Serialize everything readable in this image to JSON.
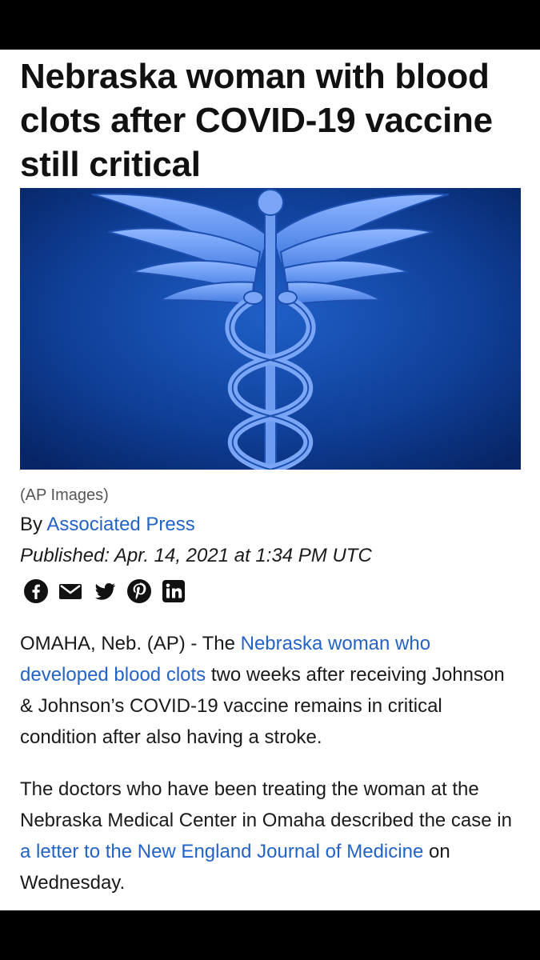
{
  "article": {
    "headline": "Nebraska woman with blood clots after COVID-19 vaccine still critical",
    "image_caption": "(AP Images)",
    "byline_prefix": "By",
    "byline_author": "Associated Press",
    "published": "Published: Apr. 14, 2021 at 1:34 PM UTC",
    "share_icons": [
      "facebook-icon",
      "email-icon",
      "twitter-icon",
      "pinterest-icon",
      "linkedin-icon"
    ],
    "paragraph1": {
      "before": "OMAHA, Neb. (AP) - The ",
      "link": "Nebraska woman who developed blood clots",
      "after": " two weeks after receiving Johnson & Johnson’s COVID-19 vaccine remains in critical condition after also having a stroke."
    },
    "paragraph2": {
      "before": "The doctors who have been treating the woman at the Nebraska Medical Center in Omaha described the case in ",
      "link": "a letter to the New England Journal of Medicine",
      "after": " on Wednesday."
    }
  },
  "colors": {
    "link": "#2363c6",
    "image_background": "#0d3a8c",
    "frame": "#000000"
  }
}
